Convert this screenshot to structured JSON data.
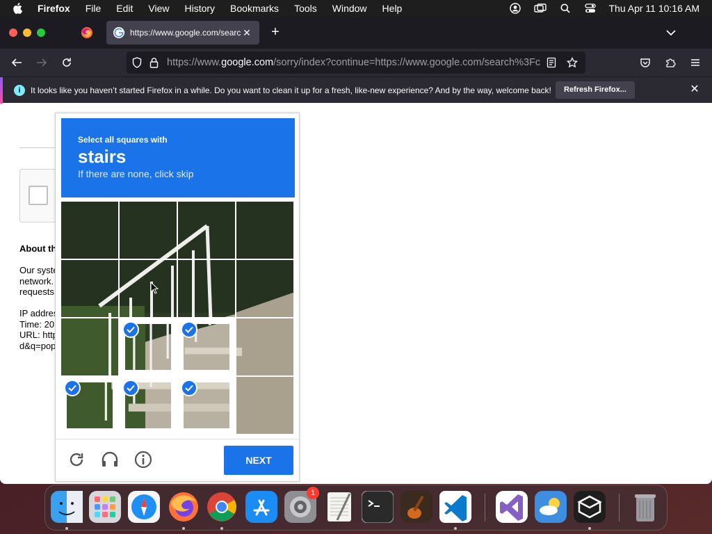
{
  "menubar": {
    "app_name": "Firefox",
    "items": [
      "File",
      "Edit",
      "View",
      "History",
      "Bookmarks",
      "Tools",
      "Window",
      "Help"
    ],
    "clock": "Thu Apr 11  10:16 AM"
  },
  "browser": {
    "tab_title": "https://www.google.com/search?",
    "url_host_prefix": "https://www.",
    "url_host": "google.com",
    "url_rest": "/sorry/index?continue=https://www.google.com/search%3Fc",
    "notification": {
      "text": "It looks like you haven’t started Firefox in a while. Do you want to clean it up for a fresh, like-new experience? And by the way, welcome back!",
      "button": "Refresh Firefox..."
    }
  },
  "page": {
    "about_heading": "About th",
    "about_text": "Our syste\nnetwork.\nrequests\n\nIP addres\nTime: 20\nURL: http\nd&q=pop"
  },
  "captcha": {
    "intro": "Select all squares with",
    "keyword": "stairs",
    "sub": "If there are none, click skip",
    "next_label": "NEXT",
    "selected_tiles": [
      9,
      10,
      12,
      13,
      14
    ]
  },
  "dock": {
    "items": [
      "finder-icon",
      "launchpad-icon",
      "safari-icon",
      "firefox-icon",
      "chrome-icon",
      "app-store-icon",
      "system-settings-icon",
      "textedit-icon",
      "terminal-icon",
      "garageband-icon",
      "vscode-icon",
      "visual-studio-icon",
      "weather-icon",
      "cube-app-icon",
      "trash-icon"
    ],
    "settings_badge": "1"
  }
}
